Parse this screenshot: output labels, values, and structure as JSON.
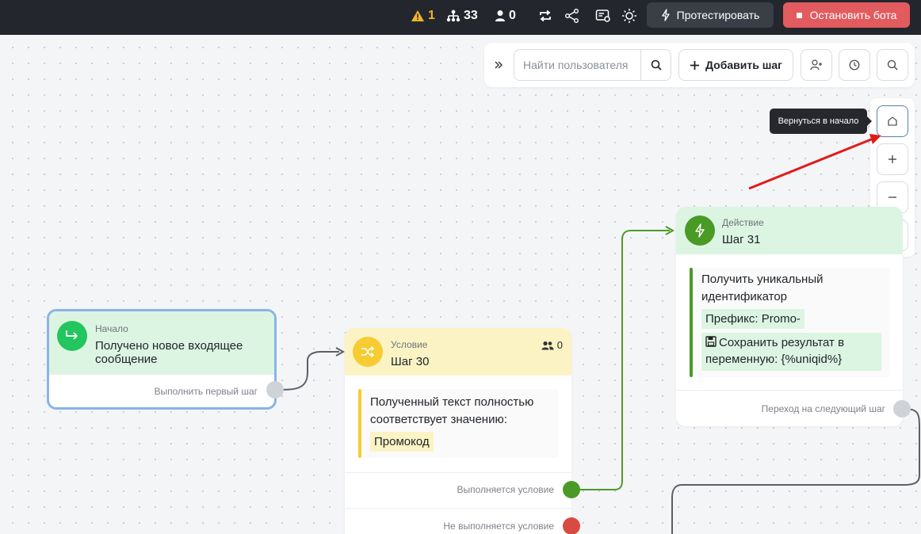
{
  "topbar": {
    "warnings_count": "1",
    "steps_count": "33",
    "users_count": "0",
    "test_label": "Протестировать",
    "stop_label": "Остановить бота",
    "colors": {
      "bg": "#23262d",
      "warning": "#f4b526",
      "stop": "#e25b5f"
    }
  },
  "toolbar": {
    "search_placeholder": "Найти пользователя",
    "add_step_label": "Добавить шаг"
  },
  "zoom": {
    "tooltip": "Вернуться в начало"
  },
  "nodes": {
    "start": {
      "type": "Начало",
      "title": "Получено новое входящее сообщение",
      "output": "Выполнить первый шаг"
    },
    "condition": {
      "type": "Условие",
      "title": "Шаг 30",
      "users": "0",
      "text": "Полученный текст полностью соответствует значению:",
      "value": "Промокод",
      "output_true": "Выполняется условие",
      "output_false": "Не выполняется условие"
    },
    "action": {
      "type": "Действие",
      "title": "Шаг 31",
      "text": "Получить уникальный идентификатор",
      "prefix": "Префикс: Promo-",
      "save": "Сохранить результат в переменную: {%uniqid%}",
      "output": "Переход на следующий шаг"
    }
  },
  "icons": [
    "warning-icon",
    "hierarchy-icon",
    "user-icon",
    "repeat-icon",
    "share-icon",
    "settings-card-icon",
    "sun-icon",
    "lightning-icon",
    "stop-icon",
    "double-chevron-right-icon",
    "search-icon",
    "plus-icon",
    "add-user-icon",
    "history-icon",
    "home-icon",
    "zoom-in-icon",
    "zoom-out-icon",
    "gear-icon",
    "arrow-right-icon",
    "shuffle-icon",
    "users-icon",
    "floppy-icon"
  ]
}
